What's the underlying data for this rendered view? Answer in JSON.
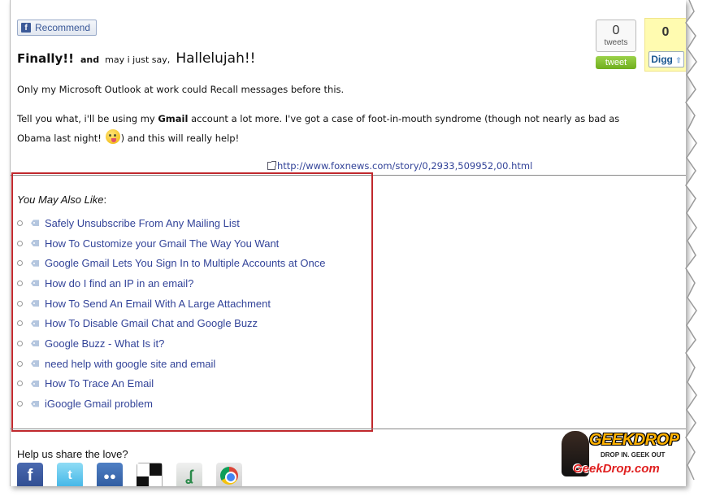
{
  "social": {
    "recommend_label": "Recommend",
    "tweet_count": "0",
    "tweet_count_label": "tweets",
    "tweet_button": "tweet",
    "digg_count": "0",
    "digg_button": "Digg"
  },
  "post": {
    "title_finally": "Finally!!",
    "title_and": "and",
    "title_may": "may i just say,",
    "title_hallelujah": "Hallelujah!!",
    "para1": "Only my Microsoft Outlook at work could Recall messages before this.",
    "para2_a": "Tell you what, i'll be using my ",
    "para2_bold": "Gmail",
    "para2_b": " account a lot more.  I've got a case of foot-in-mouth syndrome (though not nearly as bad as Obama last night! ",
    "para2_c": ") and this will really help!",
    "source_link": "http://www.foxnews.com/story/0,2933,509952,00.html"
  },
  "related": {
    "heading": "You May Also Like",
    "heading_suffix": ":",
    "items": [
      "Safely Unsubscribe From Any Mailing List",
      "How To Customize your Gmail The Way You Want",
      "Google Gmail Lets You Sign In to Multiple Accounts at Once",
      "How do I find an IP in an email?",
      "How To Send An Email With A Large Attachment",
      "How To Disable Gmail Chat and Google Buzz",
      "Google Buzz - What Is it?",
      "need help with google site and email",
      "How To Trace An Email",
      "iGoogle Gmail problem"
    ]
  },
  "share": {
    "heading": "Help us share the love?",
    "icons": [
      "facebook-icon",
      "twitter-icon",
      "myspace-icon",
      "delicious-icon",
      "stumbleupon-icon",
      "chrome-icon"
    ]
  },
  "logo": {
    "word": "GEEKDROP",
    "tagline": "DROP IN. GEEK OUT",
    "site": "GeekDrop.com"
  },
  "colors": {
    "link": "#334499",
    "highlight_border": "#c0282d",
    "tweet_green": "#6fae1d",
    "digg_yellow": "#fffbb0"
  }
}
